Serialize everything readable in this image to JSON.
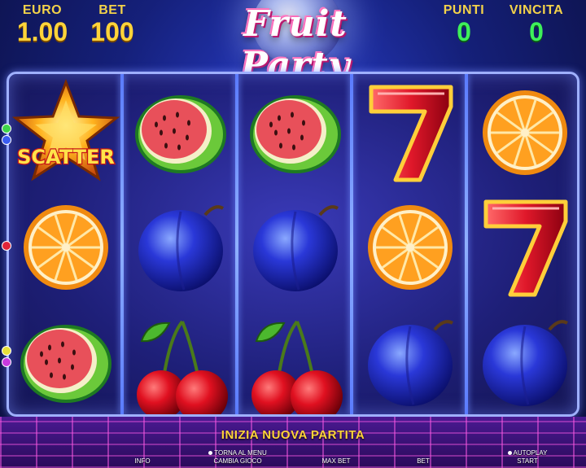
{
  "header": {
    "euro_label": "EURO",
    "euro_value": "1.00",
    "bet_label": "BET",
    "bet_value": "100",
    "points_label": "PUNTI",
    "points_value": "0",
    "win_label": "VINCITA",
    "win_value": "0",
    "logo_text": "Fruit Party"
  },
  "reels": [
    [
      "scatter",
      "orange",
      "watermelon"
    ],
    [
      "watermelon",
      "plum",
      "cherry"
    ],
    [
      "watermelon",
      "plum",
      "cherry"
    ],
    [
      "seven",
      "orange",
      "plum"
    ],
    [
      "orange",
      "seven",
      "plum"
    ]
  ],
  "scatter_text": "SCATTER",
  "footer": {
    "new_game": "INIZIA NUOVA PARTITA",
    "info": "INFO",
    "menu_top": "TORNA AL MENU",
    "menu": "CAMBIA GIOCO",
    "max_bet": "MAX BET",
    "bet": "BET",
    "autoplay": "AUTOPLAY",
    "start": "START"
  },
  "colors": {
    "accent_yellow": "#ffd43a",
    "accent_green": "#3ef05a",
    "frame_blue": "#9fb0ff"
  }
}
